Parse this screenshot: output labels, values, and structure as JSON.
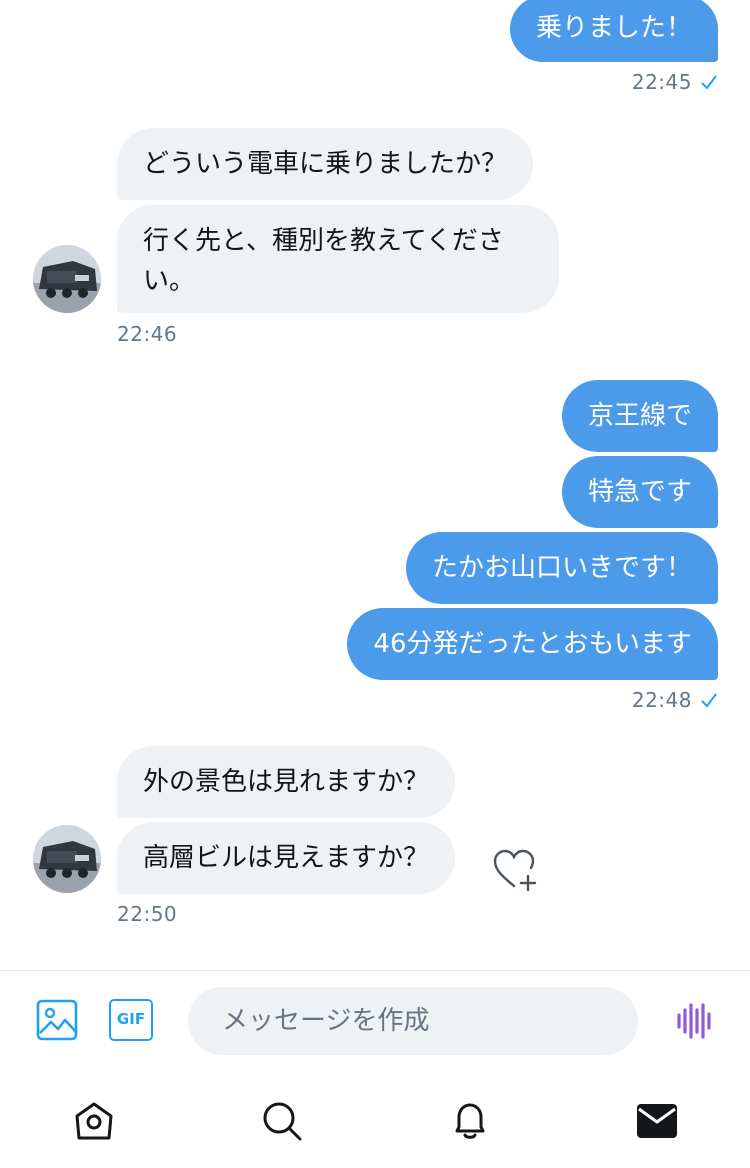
{
  "conversation": {
    "messages": [
      {
        "id": "m1",
        "side": "out",
        "text": "乗りました！"
      },
      {
        "id": "m2",
        "side": "in",
        "text": "どういう電車に乗りましたか？"
      },
      {
        "id": "m3",
        "side": "in",
        "text": "行く先と、種別を教えてください。"
      },
      {
        "id": "m4",
        "side": "out",
        "text": "京王線で"
      },
      {
        "id": "m5",
        "side": "out",
        "text": "特急です"
      },
      {
        "id": "m6",
        "side": "out",
        "text": "たかお山口いきです！"
      },
      {
        "id": "m7",
        "side": "out",
        "text": "46分発だったとおもいます"
      },
      {
        "id": "m8",
        "side": "in",
        "text": "外の景色は見れますか？"
      },
      {
        "id": "m9",
        "side": "in",
        "text": "高層ビルは見えますか？"
      }
    ],
    "timestamps": {
      "t1": "22:45",
      "t2": "22:46",
      "t3": "22:48",
      "t4": "22:50"
    }
  },
  "composer": {
    "placeholder": "メッセージを作成",
    "gif_label": "GIF"
  },
  "icons": {
    "media": "image-icon",
    "gif": "gif-icon",
    "voice": "voice-wave-icon",
    "react": "heart-plus-icon",
    "home": "home-icon",
    "search": "search-icon",
    "notifications": "bell-icon",
    "messages": "mail-icon",
    "read_receipt": "check-icon"
  },
  "colors": {
    "outgoing_bubble": "#4c9aea",
    "incoming_bubble": "#eff2f5",
    "accent": "#1da1f2",
    "voice": "#8f5bd6",
    "timestamp": "#657786"
  }
}
